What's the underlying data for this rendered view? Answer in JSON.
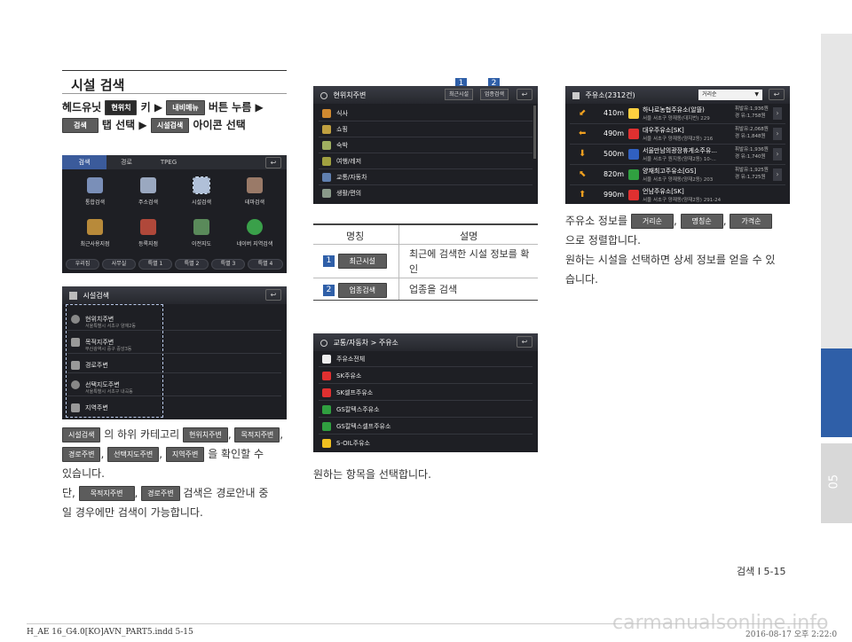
{
  "section": {
    "title": "시설 검색"
  },
  "steps": {
    "line1_prefix": "헤드유닛",
    "line1_chip1": "현위치",
    "line1_mid": "키 ▶",
    "line1_chip2": "내비메뉴",
    "line1_suffix": "버튼 누름 ▶",
    "line2_chip1": "검색",
    "line2_mid": "탭 선택 ▶",
    "line2_chip2": "시설검색",
    "line2_suffix": "아이콘 선택"
  },
  "shot1": {
    "tabs": [
      "검색",
      "경로",
      "TPEG"
    ],
    "icons": [
      "통합검색",
      "주소검색",
      "시설검색",
      "테마검색",
      "최근사용지점",
      "등록지점",
      "이전지도",
      "네이버 지역검색"
    ],
    "bottom": [
      "우리집",
      "사무실",
      "특별 1",
      "특별 2",
      "특별 3",
      "특별 4"
    ]
  },
  "shot2": {
    "header": "시설검색",
    "rows": [
      {
        "title": "현위치주변",
        "sub": "서울특별시 서초구 양재2동"
      },
      {
        "title": "목적지주변",
        "sub": "부산광역시 중구 중앙3동"
      },
      {
        "title": "경로주변",
        "sub": ""
      },
      {
        "title": "선택지도주변",
        "sub": "서울특별시 서초구 내곡동"
      },
      {
        "title": "지역주변",
        "sub": ""
      }
    ]
  },
  "para_left": {
    "chip_a": "시설검색",
    "text_a": "의 하위 카테고리",
    "chip_b": "현위치주변",
    "chip_c": "목적지주변",
    "chip_d": "경로주변",
    "chip_e": "선택지도주변",
    "chip_f": "지역주변",
    "text_b": "을 확인할 수",
    "text_c": "있습니다.",
    "text_d": "단,",
    "chip_g": "목적지주변",
    "chip_h": "경로주변",
    "text_e": "검색은 경로안내 중",
    "text_f": "일 경우에만 검색이 가능합니다."
  },
  "shot3": {
    "header": "현위치주변",
    "btn1": "최근시설",
    "btn2": "업종검색",
    "badge1": "1",
    "badge2": "2",
    "rows": [
      "식사",
      "쇼핑",
      "숙박",
      "여행/레저",
      "교통/자동차",
      "생활/편의"
    ]
  },
  "table": {
    "col1": "명칭",
    "col2": "설명",
    "rows": [
      {
        "num": "1",
        "chip": "최근시설",
        "desc": "최근에 검색한 시설 정보를 확인"
      },
      {
        "num": "2",
        "chip": "업종검색",
        "desc": "업종을 검색"
      }
    ]
  },
  "shot4": {
    "header": "교통/자동차 > 주유소",
    "rows": [
      "주유소전체",
      "SK주유소",
      "SK셀프주유소",
      "GS칼텍스주유소",
      "GS칼텍스셀프주유소",
      "S-OIL주유소"
    ]
  },
  "para_mid": "원하는 항목을 선택합니다.",
  "shot5": {
    "header": "주유소(2312건)",
    "sort": "거리순",
    "rows": [
      {
        "dist": "410m",
        "name": "하나로농협주유소(알뜰)",
        "addr": "서울 서초구 양재동(대지번) 229",
        "p1": "휘발유:1,936원",
        "p2": "경 유:1,758원"
      },
      {
        "dist": "490m",
        "name": "대우주유소[SK]",
        "addr": "서울 서초구 양재동(양재2동) 216",
        "p1": "휘발유:2,068원",
        "p2": "경 유:1,848원"
      },
      {
        "dist": "500m",
        "name": "서울만남의광장휴게소주유...",
        "addr": "서울 서초구 원지동(양재2동) 10-...",
        "p1": "휘발유:1,936원",
        "p2": "경 유:1,740원"
      },
      {
        "dist": "820m",
        "name": "양재최고주유소[GS]",
        "addr": "서울 서초구 양재동(양재2동) 203",
        "p1": "휘발유:1,925원",
        "p2": "경 유:1,725원"
      },
      {
        "dist": "990m",
        "name": "언남주유소[SK]",
        "addr": "서울 서초구 양재동(양재2동) 291-24",
        "p1": "",
        "p2": ""
      }
    ]
  },
  "para_right": {
    "t1": "주유소 정보를",
    "chip1": "거리순",
    "chip2": "명칭순",
    "chip3": "가격순",
    "t2": "으로 정렬합니다.",
    "t3": "원하는 시설을 선택하면 상세 정보를 얻을 수 있",
    "t4": "습니다."
  },
  "side_tab": "05",
  "page_label": "검색 I 5-15",
  "footer_left": "H_AE 16_G4.0[KO]AVN_PART5.indd   5-15",
  "footer_right": "2016-08-17   오후 2:22:0",
  "watermark": "carmanualsonline.info"
}
